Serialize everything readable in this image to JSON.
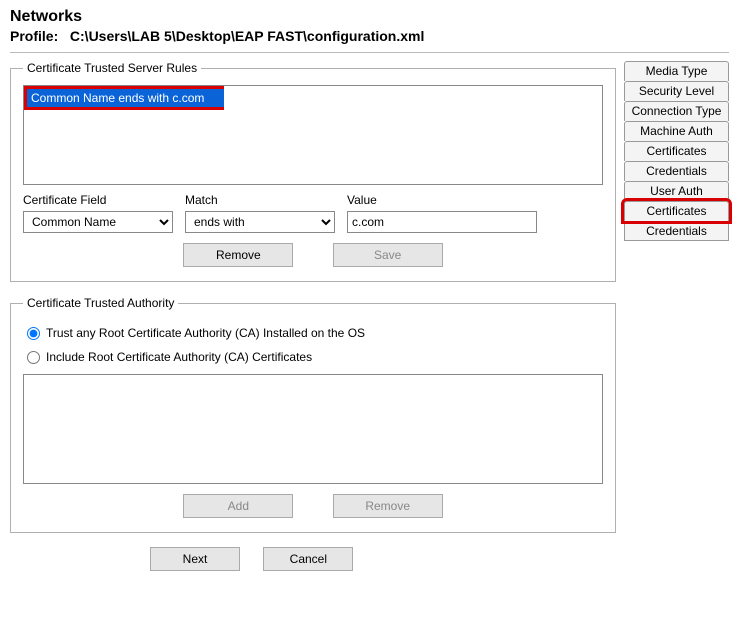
{
  "header": {
    "title": "Networks",
    "profile_label": "Profile:",
    "profile_path": "C:\\Users\\LAB 5\\Desktop\\EAP FAST\\configuration.xml"
  },
  "rules": {
    "legend": "Certificate Trusted Server Rules",
    "items": [
      "Common Name ends with c.com"
    ],
    "field_label": "Certificate Field",
    "field_value": "Common Name",
    "match_label": "Match",
    "match_value": "ends with",
    "value_label": "Value",
    "value_value": "c.com",
    "remove_label": "Remove",
    "save_label": "Save"
  },
  "authority": {
    "legend": "Certificate Trusted Authority",
    "opt1": "Trust any Root Certificate Authority (CA) Installed on the OS",
    "opt2": "Include Root Certificate Authority (CA) Certificates",
    "add_label": "Add",
    "remove_label": "Remove"
  },
  "footer": {
    "next_label": "Next",
    "cancel_label": "Cancel"
  },
  "tabs": [
    {
      "label": "Media Type",
      "hl": false
    },
    {
      "label": "Security Level",
      "hl": false
    },
    {
      "label": "Connection Type",
      "hl": false
    },
    {
      "label": "Machine Auth",
      "hl": false
    },
    {
      "label": "Certificates",
      "hl": false
    },
    {
      "label": "Credentials",
      "hl": false
    },
    {
      "label": "User Auth",
      "hl": false
    },
    {
      "label": "Certificates",
      "hl": true
    },
    {
      "label": "Credentials",
      "hl": false
    }
  ]
}
